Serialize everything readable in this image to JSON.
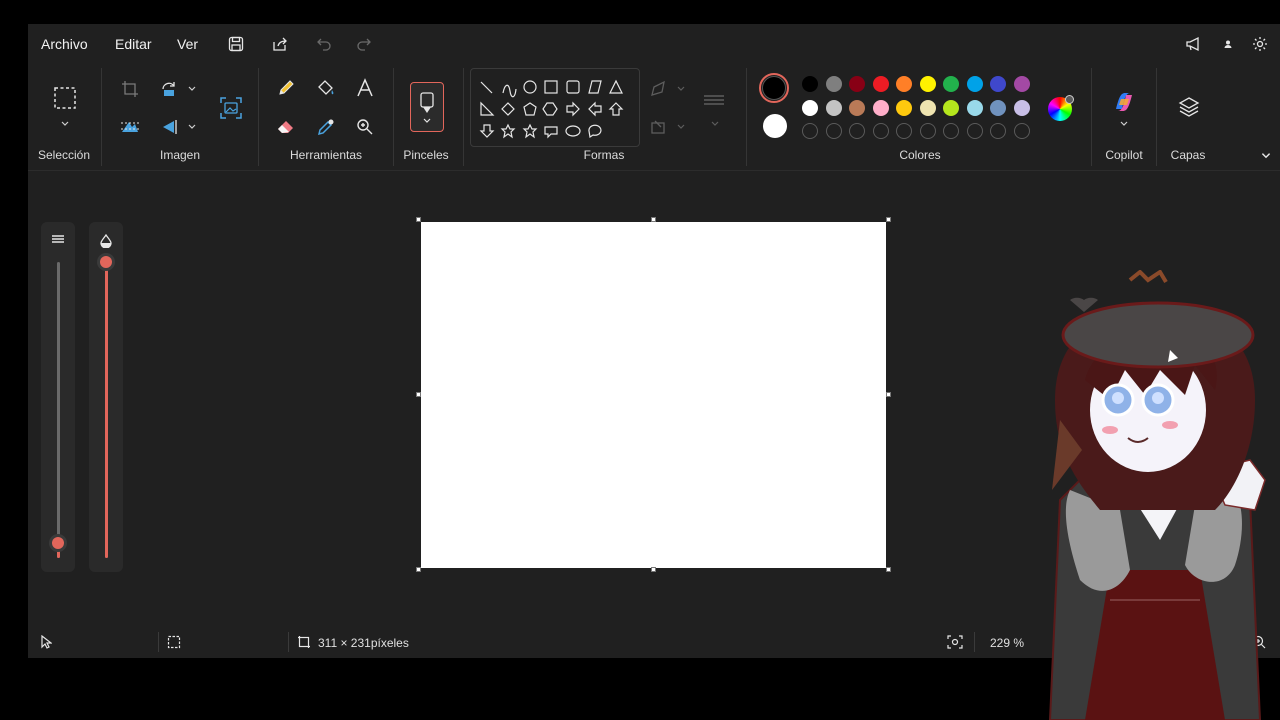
{
  "menu": {
    "archivo": "Archivo",
    "editar": "Editar",
    "ver": "Ver"
  },
  "toolbar_icons": [
    "save-icon",
    "share-icon",
    "undo-icon",
    "redo-icon",
    "megaphone-icon",
    "account-icon",
    "settings-icon"
  ],
  "groups": {
    "seleccion": "Selección",
    "imagen": "Imagen",
    "herramientas": "Herramientas",
    "pinceles": "Pinceles",
    "formas": "Formas",
    "colores": "Colores",
    "copilot": "Copilot",
    "capas": "Capas"
  },
  "colors": {
    "primary": "#000000",
    "secondary": "#ffffff",
    "palette_row1": [
      "#000000",
      "#7f7f7f",
      "#880015",
      "#ed1c24",
      "#ff7f27",
      "#fff200",
      "#22b14c",
      "#00a2e8",
      "#3f48cc",
      "#a349a4"
    ],
    "palette_row2": [
      "#ffffff",
      "#c3c3c3",
      "#b97a57",
      "#ffaec9",
      "#ffc90e",
      "#efe4b0",
      "#b5e61d",
      "#99d9ea",
      "#7092be",
      "#c8bfe7"
    ],
    "accent_slider": "#e2665b"
  },
  "sliders": {
    "size_level": 0.05,
    "opacity_level": 1.0
  },
  "status": {
    "canvas_size": "311 × 231píxeles",
    "zoom": "229 %"
  }
}
